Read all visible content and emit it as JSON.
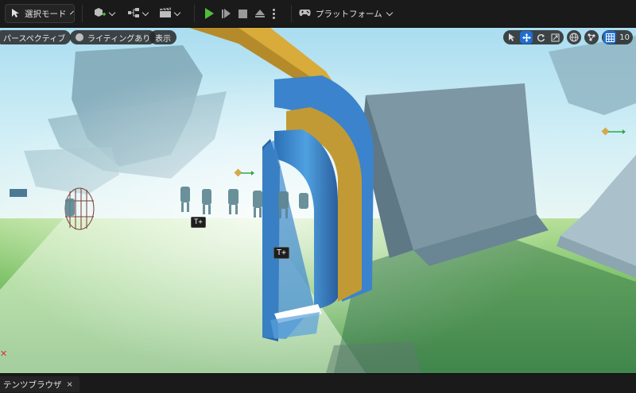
{
  "toolbar": {
    "mode_label": "選択モード",
    "platform_label": "プラットフォーム"
  },
  "viewport": {
    "perspective_label": "パースペクティブ",
    "lighting_label": "ライティングあり",
    "show_label": "表示",
    "grid_snap_value": "10",
    "marker_label": "T+"
  },
  "bottom": {
    "drawer_tab_label": "テンツブラウザ",
    "close_glyph": "×"
  },
  "colors": {
    "accent_blue": "#1f6fd1",
    "play_green": "#4fbf3a",
    "sky": "#bfe6f2",
    "grass": "#7fc36a"
  }
}
